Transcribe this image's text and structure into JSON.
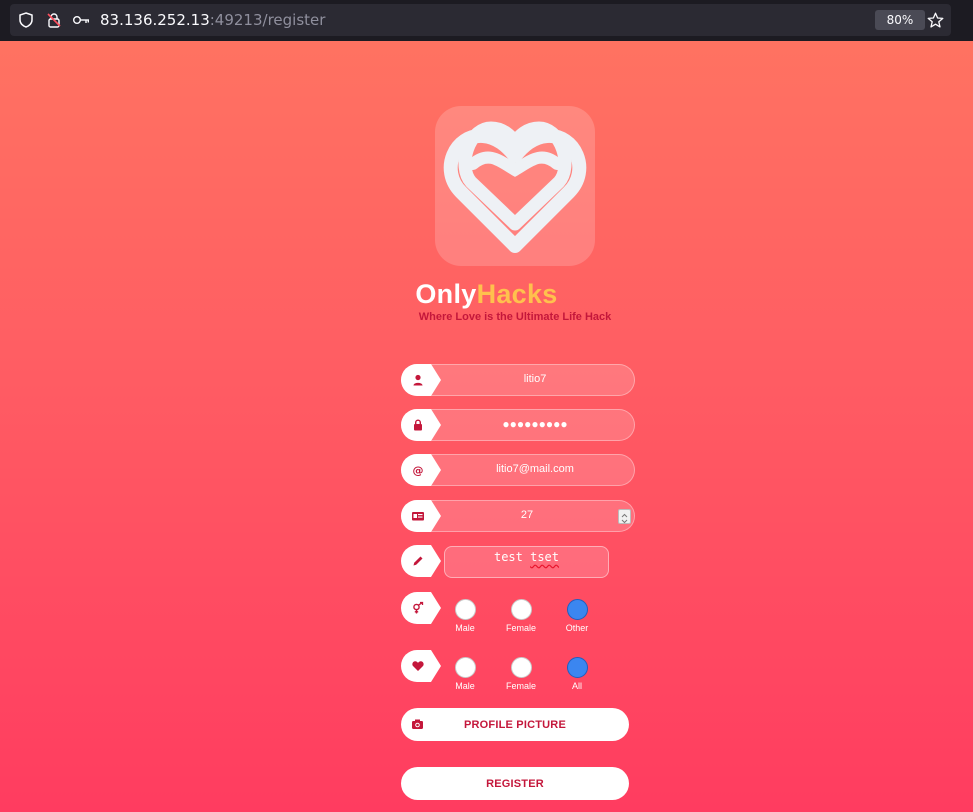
{
  "browser": {
    "url_host": "83.136.252.13",
    "url_rest": ":49213/register",
    "zoom": "80%",
    "icons": [
      "shield-icon",
      "lock-warning-icon",
      "key-icon",
      "star-icon"
    ]
  },
  "brand": {
    "name_part1": "Only",
    "name_part2": "Hacks",
    "tagline": "Where Love is the Ultimate Life Hack"
  },
  "form": {
    "username": "litio7",
    "password_mask": "●●●●●●●●●",
    "email": "litio7@mail.com",
    "age": "27",
    "bio_word1": "test",
    "bio_word2": "tset",
    "gender": {
      "options": [
        "Male",
        "Female",
        "Other"
      ],
      "selected": "Other"
    },
    "interested_in": {
      "options": [
        "Male",
        "Female",
        "All"
      ],
      "selected": "All"
    },
    "profile_picture_label": "PROFILE PICTURE",
    "register_label": "REGISTER"
  },
  "colors": {
    "gradient_top": "#ff7561",
    "gradient_bottom": "#ff3c60",
    "accent_red": "#c4173b",
    "accent_yellow": "#ffc14d",
    "radio_selected": "#3b86f0"
  }
}
